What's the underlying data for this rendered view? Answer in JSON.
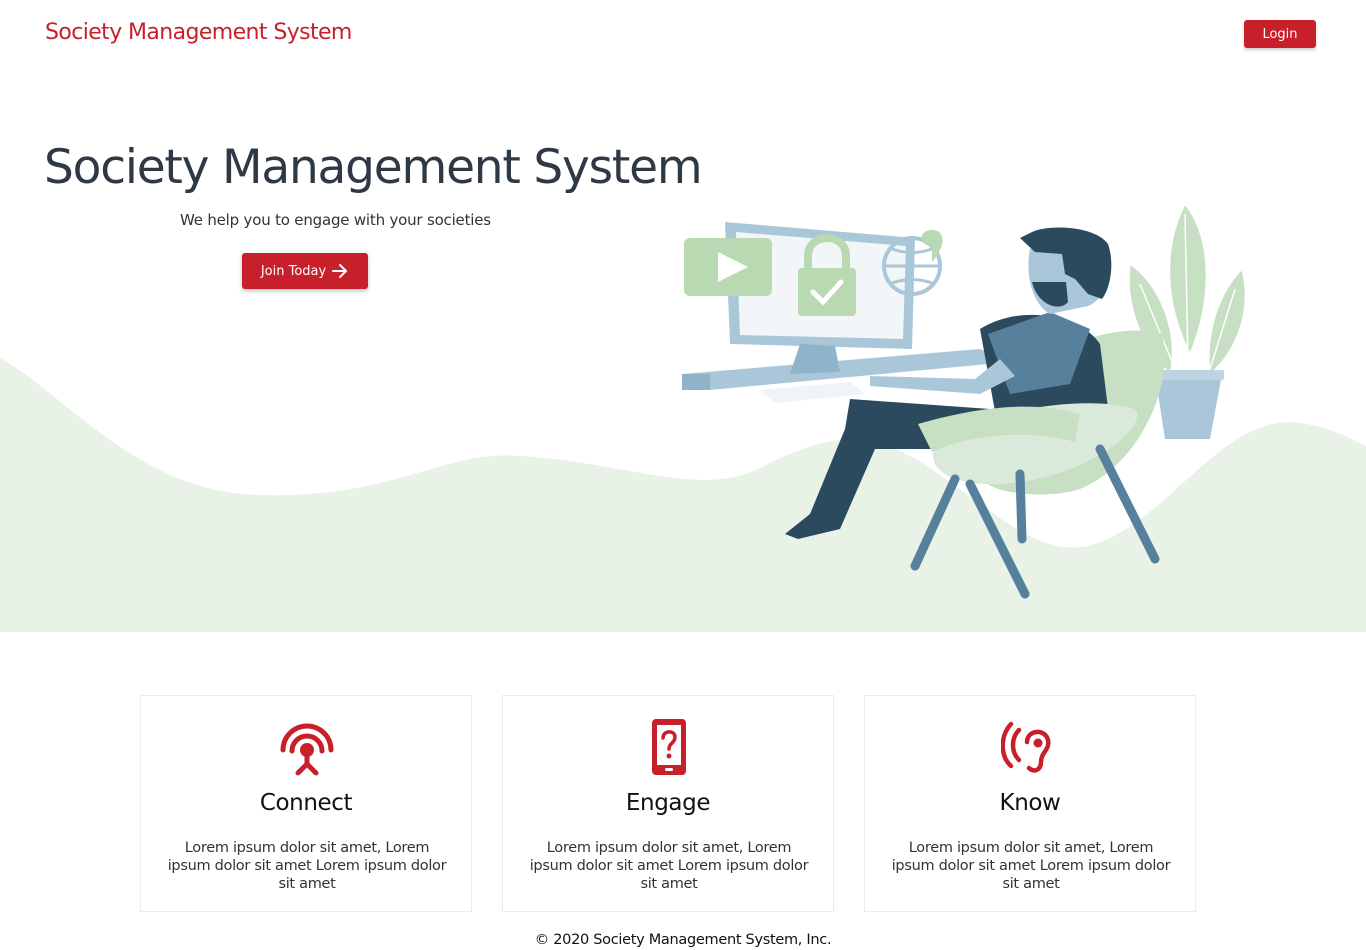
{
  "navbar": {
    "brand": "Society Management System",
    "login_label": "Login"
  },
  "hero": {
    "title": "Society Management System",
    "subtitle": "We help you to engage with your societies",
    "cta_label": "Join Today",
    "cta_icon": "arrow-right-icon",
    "illustration": "man-at-computer-illustration"
  },
  "features": [
    {
      "icon": "broadcast-antenna-icon",
      "title": "Connect",
      "text": "Lorem ipsum dolor sit amet, Lorem ipsum dolor sit amet Lorem ipsum dolor sit amet"
    },
    {
      "icon": "phone-question-icon",
      "title": "Engage",
      "text": "Lorem ipsum dolor sit amet, Lorem ipsum dolor sit amet Lorem ipsum dolor sit amet"
    },
    {
      "icon": "ear-sound-icon",
      "title": "Know",
      "text": "Lorem ipsum dolor sit amet, Lorem ipsum dolor sit amet Lorem ipsum dolor sit amet"
    }
  ],
  "footer": {
    "copyright": "© 2020 Society Management System, Inc."
  },
  "colors": {
    "accent": "#c8202a",
    "hero_wave": "#e8f2e6",
    "title_text": "#2f3945"
  }
}
